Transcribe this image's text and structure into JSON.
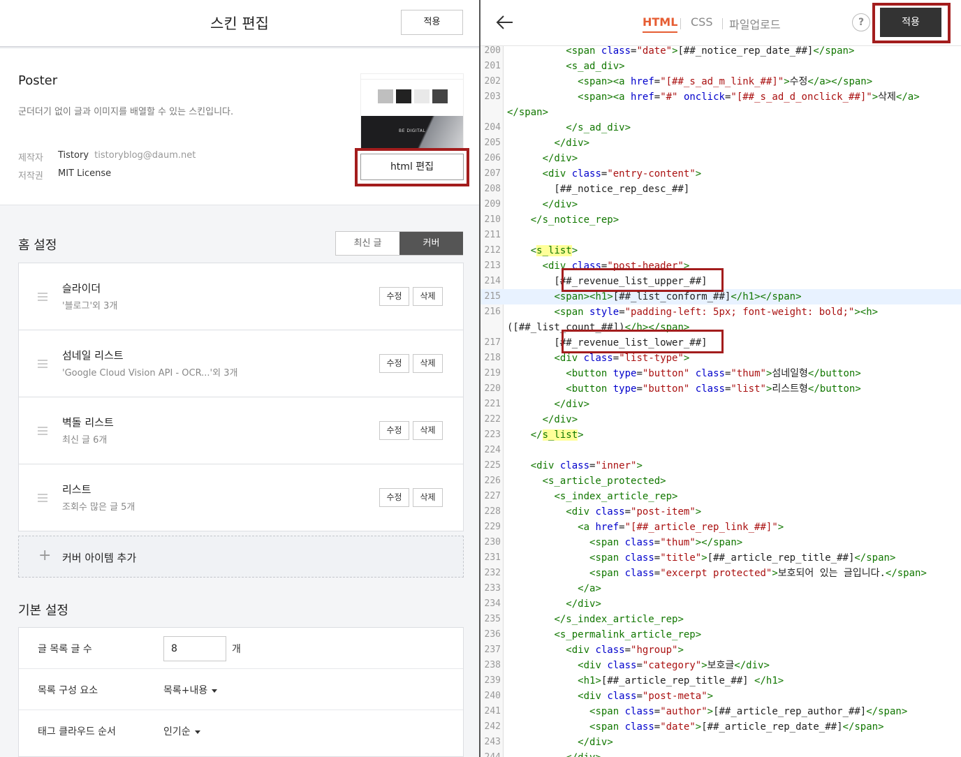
{
  "left": {
    "title": "스킨 편집",
    "apply_label": "적용",
    "skin": {
      "name": "Poster",
      "description": "군더더기 없이 글과 이미지를 배열할 수 있는 스킨입니다.",
      "author_label": "제작자",
      "author": "Tistory",
      "author_email": "tistoryblog@daum.net",
      "license_label": "저작권",
      "license": "MIT License",
      "thumbnail_text": "BE DIGITAL",
      "html_edit_label": "html 편집"
    },
    "home": {
      "title": "홈 설정",
      "tab_latest": "최신 글",
      "tab_cover": "커버",
      "items": [
        {
          "name": "슬라이더",
          "sub": "'블로그'외 3개",
          "edit": "수정",
          "delete": "삭제"
        },
        {
          "name": "섬네일 리스트",
          "sub": "'Google Cloud Vision API - OCR...'외 3개",
          "edit": "수정",
          "delete": "삭제"
        },
        {
          "name": "벽돌 리스트",
          "sub": "최신 글 6개",
          "edit": "수정",
          "delete": "삭제"
        },
        {
          "name": "리스트",
          "sub": "조회수 많은 글 5개",
          "edit": "수정",
          "delete": "삭제"
        }
      ],
      "add_label": "커버 아이템 추가"
    },
    "basic": {
      "title": "기본 설정",
      "post_count_label": "글 목록 글 수",
      "post_count_value": "8",
      "post_count_unit": "개",
      "list_elements_label": "목록 구성 요소",
      "list_elements_value": "목록+내용",
      "tag_order_label": "태그 클라우드 순서",
      "tag_order_value": "인기순"
    }
  },
  "right": {
    "tabs": {
      "html": "HTML",
      "css": "CSS",
      "upload": "파일업로드"
    },
    "help": "?",
    "apply_label": "적용",
    "cursor_line": 215,
    "lines": [
      {
        "n": "200",
        "html": "          <span class=\"date\">[##_notice_rep_date_##]</span>"
      },
      {
        "n": "201",
        "html": "          <s_ad_div>"
      },
      {
        "n": "202",
        "html": "            <span><a href=\"[##_s_ad_m_link_##]\">수정</a></span>"
      },
      {
        "n": "203",
        "html": "            <span><a href=\"#\" onclick=\"[##_s_ad_d_onclick_##]\">삭제</a>"
      },
      {
        "n": "",
        "html": "</span>"
      },
      {
        "n": "204",
        "html": "          </s_ad_div>"
      },
      {
        "n": "205",
        "html": "        </div>"
      },
      {
        "n": "206",
        "html": "      </div>"
      },
      {
        "n": "207",
        "html": "      <div class=\"entry-content\">"
      },
      {
        "n": "208",
        "html": "        [##_notice_rep_desc_##]"
      },
      {
        "n": "209",
        "html": "      </div>"
      },
      {
        "n": "210",
        "html": "    </s_notice_rep>"
      },
      {
        "n": "211",
        "html": ""
      },
      {
        "n": "212",
        "html": "    <s_list>"
      },
      {
        "n": "213",
        "html": "      <div class=\"post-header\">"
      },
      {
        "n": "214",
        "html": "        [##_revenue_list_upper_##]"
      },
      {
        "n": "215",
        "html": "        <span><h1>[##_list_conform_##]</h1></span>"
      },
      {
        "n": "216",
        "html": "        <span style=\"padding-left: 5px; font-weight: bold;\"><h>"
      },
      {
        "n": "",
        "html": "([##_list_count_##])</h></span>"
      },
      {
        "n": "217",
        "html": "        [##_revenue_list_lower_##]"
      },
      {
        "n": "218",
        "html": "        <div class=\"list-type\">"
      },
      {
        "n": "219",
        "html": "          <button type=\"button\" class=\"thum\">섬네일형</button>"
      },
      {
        "n": "220",
        "html": "          <button type=\"button\" class=\"list\">리스트형</button>"
      },
      {
        "n": "221",
        "html": "        </div>"
      },
      {
        "n": "222",
        "html": "      </div>"
      },
      {
        "n": "223",
        "html": "    </s_list>"
      },
      {
        "n": "224",
        "html": ""
      },
      {
        "n": "225",
        "html": "    <div class=\"inner\">"
      },
      {
        "n": "226",
        "html": "      <s_article_protected>"
      },
      {
        "n": "227",
        "html": "        <s_index_article_rep>"
      },
      {
        "n": "228",
        "html": "          <div class=\"post-item\">"
      },
      {
        "n": "229",
        "html": "            <a href=\"[##_article_rep_link_##]\">"
      },
      {
        "n": "230",
        "html": "              <span class=\"thum\"></span>"
      },
      {
        "n": "231",
        "html": "              <span class=\"title\">[##_article_rep_title_##]</span>"
      },
      {
        "n": "232",
        "html": "              <span class=\"excerpt protected\">보호되어 있는 글입니다.</span>"
      },
      {
        "n": "233",
        "html": "            </a>"
      },
      {
        "n": "234",
        "html": "          </div>"
      },
      {
        "n": "235",
        "html": "        </s_index_article_rep>"
      },
      {
        "n": "236",
        "html": "        <s_permalink_article_rep>"
      },
      {
        "n": "237",
        "html": "          <div class=\"hgroup\">"
      },
      {
        "n": "238",
        "html": "            <div class=\"category\">보호글</div>"
      },
      {
        "n": "239",
        "html": "            <h1>[##_article_rep_title_##] </h1>"
      },
      {
        "n": "240",
        "html": "            <div class=\"post-meta\">"
      },
      {
        "n": "241",
        "html": "              <span class=\"author\">[##_article_rep_author_##]</span>"
      },
      {
        "n": "242",
        "html": "              <span class=\"date\">[##_article_rep_date_##]</span>"
      },
      {
        "n": "243",
        "html": "            </div>"
      },
      {
        "n": "244",
        "html": "          </div>"
      }
    ]
  },
  "colors": {
    "accent": "#e65d33",
    "annotation_red": "#a31d1d",
    "apply_dark": "#333333",
    "tag_green": "#117700",
    "attr_blue": "#0000cc",
    "string_red": "#aa1111"
  }
}
